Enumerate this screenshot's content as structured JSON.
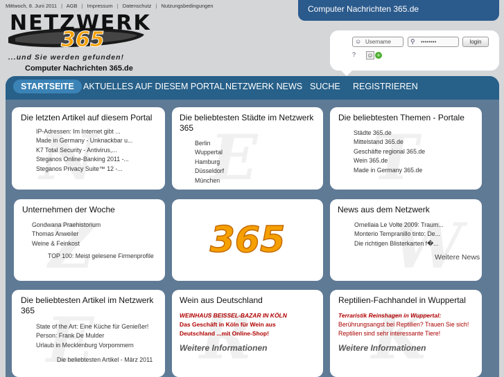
{
  "topbar": {
    "date": "Mittwoch, 8. Juni 2011",
    "links": [
      "AGB",
      "Impressum",
      "Datenschutz",
      "Nutzungsbedingungen"
    ]
  },
  "logo": {
    "word": "NETZWERK",
    "number": "365",
    "tagline": "...und Sie werden gefunden!",
    "subtitle": "Computer Nachrichten 365.de"
  },
  "header_tab": {
    "label": "Computer Nachrichten 365.de"
  },
  "login": {
    "username_placeholder": "Username",
    "password_value": "••••••••",
    "button_label": "login",
    "help_icon": "?",
    "contact_icon": "☺",
    "add_icon": "+"
  },
  "nav": [
    "STARTSEITE",
    "AKTUELLES AUF DIESEM PORTAL",
    "NETZWERK NEWS",
    "SUCHE",
    "REGISTRIEREN"
  ],
  "boxes": {
    "latest": {
      "title": "Die letzten Artikel auf diesem Portal",
      "items": [
        "IP-Adressen: Im Internet gibt ...",
        "Made in Germany - Unknackbar u...",
        "K7 Total Security - Antivirus,...",
        "Steganos Online-Banking 2011 -...",
        "Steganos Privacy Suite™ 12 -..."
      ]
    },
    "cities": {
      "title": "Die beliebtesten Städte im Netzwerk 365",
      "items": [
        "Berlin",
        "Wuppertal",
        "Hamburg",
        "Düsseldorf",
        "München"
      ]
    },
    "themes": {
      "title": "Die beliebtesten Themen - Portale",
      "items": [
        "Städte 365.de",
        "Mittelstand 365.de",
        "Geschäfte regional 365.de",
        "Wein 365.de",
        "Made in Germany 365.de"
      ]
    },
    "companies": {
      "title": "Unternehmen der Woche",
      "items": [
        "Gondwana Praehistorium",
        "Thomas Anweiler",
        "Weine & Feinkost"
      ],
      "more": "TOP 100: Meist gelesene Firmenprofile"
    },
    "logo365": {
      "text": "365"
    },
    "news": {
      "title": "News aus dem Netzwerk",
      "items": [
        "Ornellaia Le Volte 2009: Traum...",
        "Monterio Tempranillo tinto: De...",
        "Die richtigen Blisterkarten f�..."
      ],
      "more": "Weitere News"
    },
    "articles": {
      "title": "Die beliebtesten Artikel im Netzwerk 365",
      "items": [
        "State of the Art: Eine Küche für Genießer!",
        "Person: Frank De Mulder",
        "Urlaub in Mecklenburg Vorpommern"
      ],
      "more": "Die beliebtesten Artikel - März 2011"
    },
    "wine": {
      "title": "Wein aus Deutschland",
      "headline": "WEINHAUS BEISSEL-BAZAR IN KÖLN",
      "text": "Das Geschäft in Köln für Wein aus Deutschland ...mit Online-Shop!",
      "more": "Weitere Informationen"
    },
    "reptile": {
      "title": "Reptilien-Fachhandel in Wuppertal",
      "headline": "Terraristik Reinshagen in Wuppertal:",
      "text": "Berührungsangst bei Reptilien? Trauen Sie sich! Reptilien sind sehr interessante Tiere!",
      "more": "Weitere Informationen"
    }
  },
  "colors": {
    "nav": "#276089",
    "nav_active": "#3b83b6",
    "panel": "#5f7a95",
    "logo_orange": "#f5a000",
    "accent_red": "#b00000"
  }
}
